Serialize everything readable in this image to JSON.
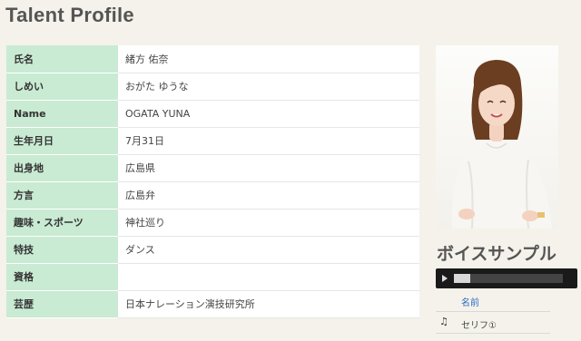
{
  "page": {
    "title": "Talent Profile"
  },
  "profile": {
    "rows": [
      {
        "label": "氏名",
        "value": "緒方 佑奈"
      },
      {
        "label": "しめい",
        "value": "おがた ゆうな"
      },
      {
        "label": "Name",
        "value": "OGATA YUNA"
      },
      {
        "label": "生年月日",
        "value": "7月31日"
      },
      {
        "label": "出身地",
        "value": "広島県"
      },
      {
        "label": "方言",
        "value": "広島弁"
      },
      {
        "label": "趣味・スポーツ",
        "value": "神社巡り"
      },
      {
        "label": "特技",
        "value": "ダンス"
      },
      {
        "label": "資格",
        "value": ""
      },
      {
        "label": "芸歴",
        "value": "日本ナレーション演技研究所"
      }
    ]
  },
  "voice": {
    "heading": "ボイスサンプル",
    "player": {
      "progress": 0.15
    },
    "track_name": "名前",
    "tracks": [
      {
        "icon": "music-note-icon",
        "label": "セリフ①"
      }
    ]
  },
  "colors": {
    "label_bg": "#c9ead3",
    "link": "#2b6cc4",
    "page_bg": "#f4f2ea"
  }
}
